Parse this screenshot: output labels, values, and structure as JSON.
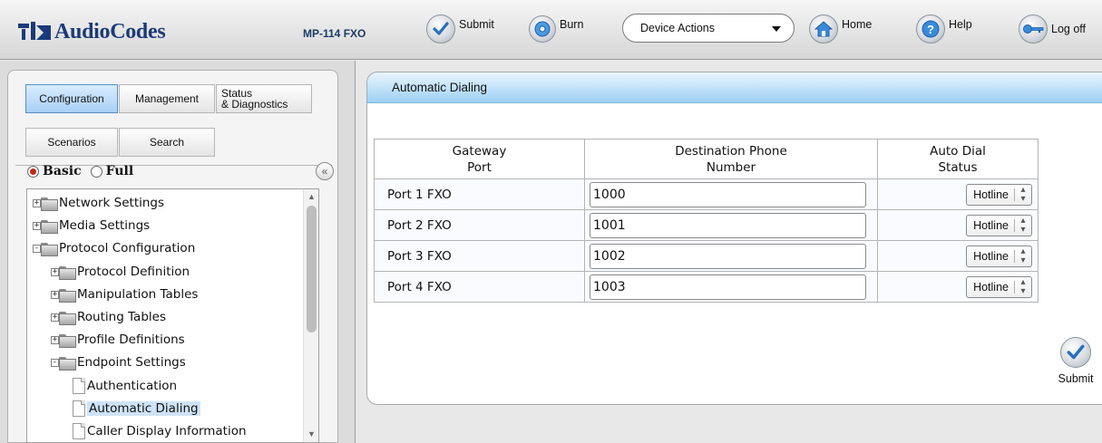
{
  "header": {
    "brand": "AudioCodes",
    "model": "MP-114 FXO",
    "submit_label": "Submit",
    "burn_label": "Burn",
    "device_actions_label": "Device Actions",
    "home_label": "Home",
    "help_label": "Help",
    "logoff_label": "Log off"
  },
  "nav": {
    "tabs": {
      "configuration": "Configuration",
      "management": "Management",
      "status_l1": "Status",
      "status_l2": "& Diagnostics",
      "scenarios": "Scenarios",
      "search": "Search"
    },
    "mode": {
      "basic": "Basic",
      "full": "Full",
      "selected": "Basic"
    },
    "tree": [
      {
        "label": "Network Settings",
        "type": "folder",
        "expander": "+"
      },
      {
        "label": "Media Settings",
        "type": "folder",
        "expander": "+"
      },
      {
        "label": "Protocol Configuration",
        "type": "folder",
        "expander": "-"
      },
      {
        "label": "Protocol Definition",
        "type": "folder",
        "expander": "+"
      },
      {
        "label": "Manipulation Tables",
        "type": "folder",
        "expander": "+"
      },
      {
        "label": "Routing Tables",
        "type": "folder",
        "expander": "+"
      },
      {
        "label": "Profile Definitions",
        "type": "folder",
        "expander": "+"
      },
      {
        "label": "Endpoint Settings",
        "type": "folder",
        "expander": "-"
      },
      {
        "label": "Authentication",
        "type": "page"
      },
      {
        "label": "Automatic Dialing",
        "type": "page",
        "selected": true
      },
      {
        "label": "Caller Display Information",
        "type": "page"
      }
    ]
  },
  "main": {
    "title": "Automatic Dialing",
    "columns": {
      "port_l1": "Gateway",
      "port_l2": "Port",
      "dest_l1": "Destination Phone",
      "dest_l2": "Number",
      "status_l1": "Auto Dial",
      "status_l2": "Status"
    },
    "rows": [
      {
        "port": "Port 1  FXO",
        "number": "1000",
        "status": "Hotline"
      },
      {
        "port": "Port 2  FXO",
        "number": "1001",
        "status": "Hotline"
      },
      {
        "port": "Port 3  FXO",
        "number": "1002",
        "status": "Hotline"
      },
      {
        "port": "Port 4  FXO",
        "number": "1003",
        "status": "Hotline"
      }
    ],
    "submit_label": "Submit"
  }
}
